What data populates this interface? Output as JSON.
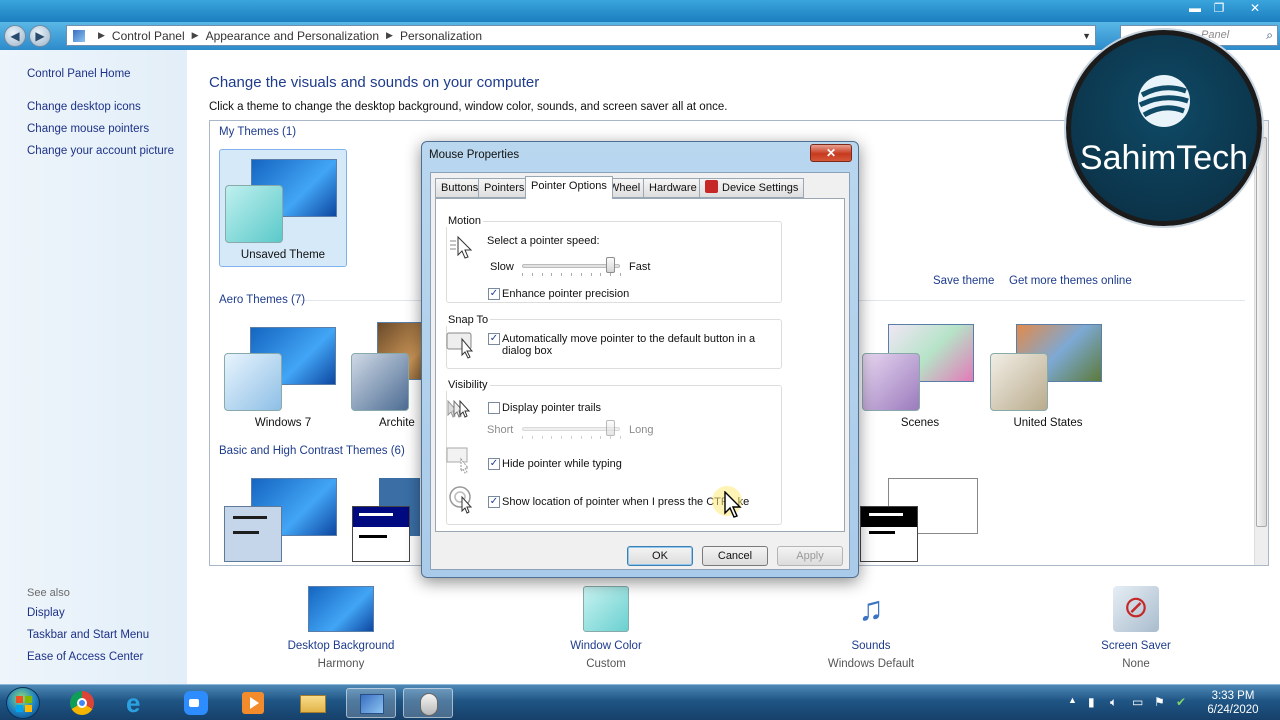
{
  "window": {
    "minimize": "▬",
    "maximize": "❐",
    "close": "✕"
  },
  "address": {
    "crumbs": [
      "Control Panel",
      "Appearance and Personalization",
      "Personalization"
    ],
    "search_placeholder": "Panel"
  },
  "sidebar": {
    "home": "Control Panel Home",
    "links": [
      "Change desktop icons",
      "Change mouse pointers",
      "Change your account picture"
    ],
    "see_also_title": "See also",
    "see_also": [
      "Display",
      "Taskbar and Start Menu",
      "Ease of Access Center"
    ]
  },
  "main": {
    "headline": "Change the visuals and sounds on your computer",
    "subline": "Click a theme to change the desktop background, window color, sounds, and screen saver all at once.",
    "groups": {
      "my_themes": "My Themes (1)",
      "aero_themes": "Aero Themes (7)",
      "basic_themes": "Basic and High Contrast Themes (6)"
    },
    "themes": {
      "unsaved": "Unsaved Theme",
      "windows7": "Windows 7",
      "architecture": "Archite",
      "scenes": "Scenes",
      "united_states": "United States"
    },
    "save_theme": "Save theme",
    "get_more": "Get more themes online"
  },
  "bottom": [
    {
      "title": "Desktop Background",
      "sub": "Harmony"
    },
    {
      "title": "Window Color",
      "sub": "Custom"
    },
    {
      "title": "Sounds",
      "sub": "Windows Default"
    },
    {
      "title": "Screen Saver",
      "sub": "None"
    }
  ],
  "dialog": {
    "title": "Mouse Properties",
    "close": "✕",
    "tabs": [
      "Buttons",
      "Pointers",
      "Pointer Options",
      "Wheel",
      "Hardware",
      "Device Settings"
    ],
    "motion": {
      "title": "Motion",
      "speed_label": "Select a pointer speed:",
      "slow": "Slow",
      "fast": "Fast",
      "speed_value": 0.9,
      "precision": "Enhance pointer precision",
      "precision_checked": true
    },
    "snap": {
      "title": "Snap To",
      "line1": "Automatically move pointer to the default button in a",
      "line2": "dialog box",
      "checked": true
    },
    "visibility": {
      "title": "Visibility",
      "trails": "Display pointer trails",
      "trails_checked": false,
      "short": "Short",
      "long": "Long",
      "trail_value": 0.9,
      "hide": "Hide pointer while typing",
      "hide_checked": true,
      "show_location": "Show location of pointer when I press the CTRL ke",
      "show_checked": true
    },
    "buttons": {
      "ok": "OK",
      "cancel": "Cancel",
      "apply": "Apply"
    },
    "check_glyph": "✓"
  },
  "logo": {
    "text": "SahimTech"
  },
  "taskbar": {
    "time": "3:33 PM",
    "date": "6/24/2020"
  },
  "colors": {
    "link": "#1e3c8c",
    "taskbar": "#1f5584",
    "close_button": "#c73a1f"
  }
}
